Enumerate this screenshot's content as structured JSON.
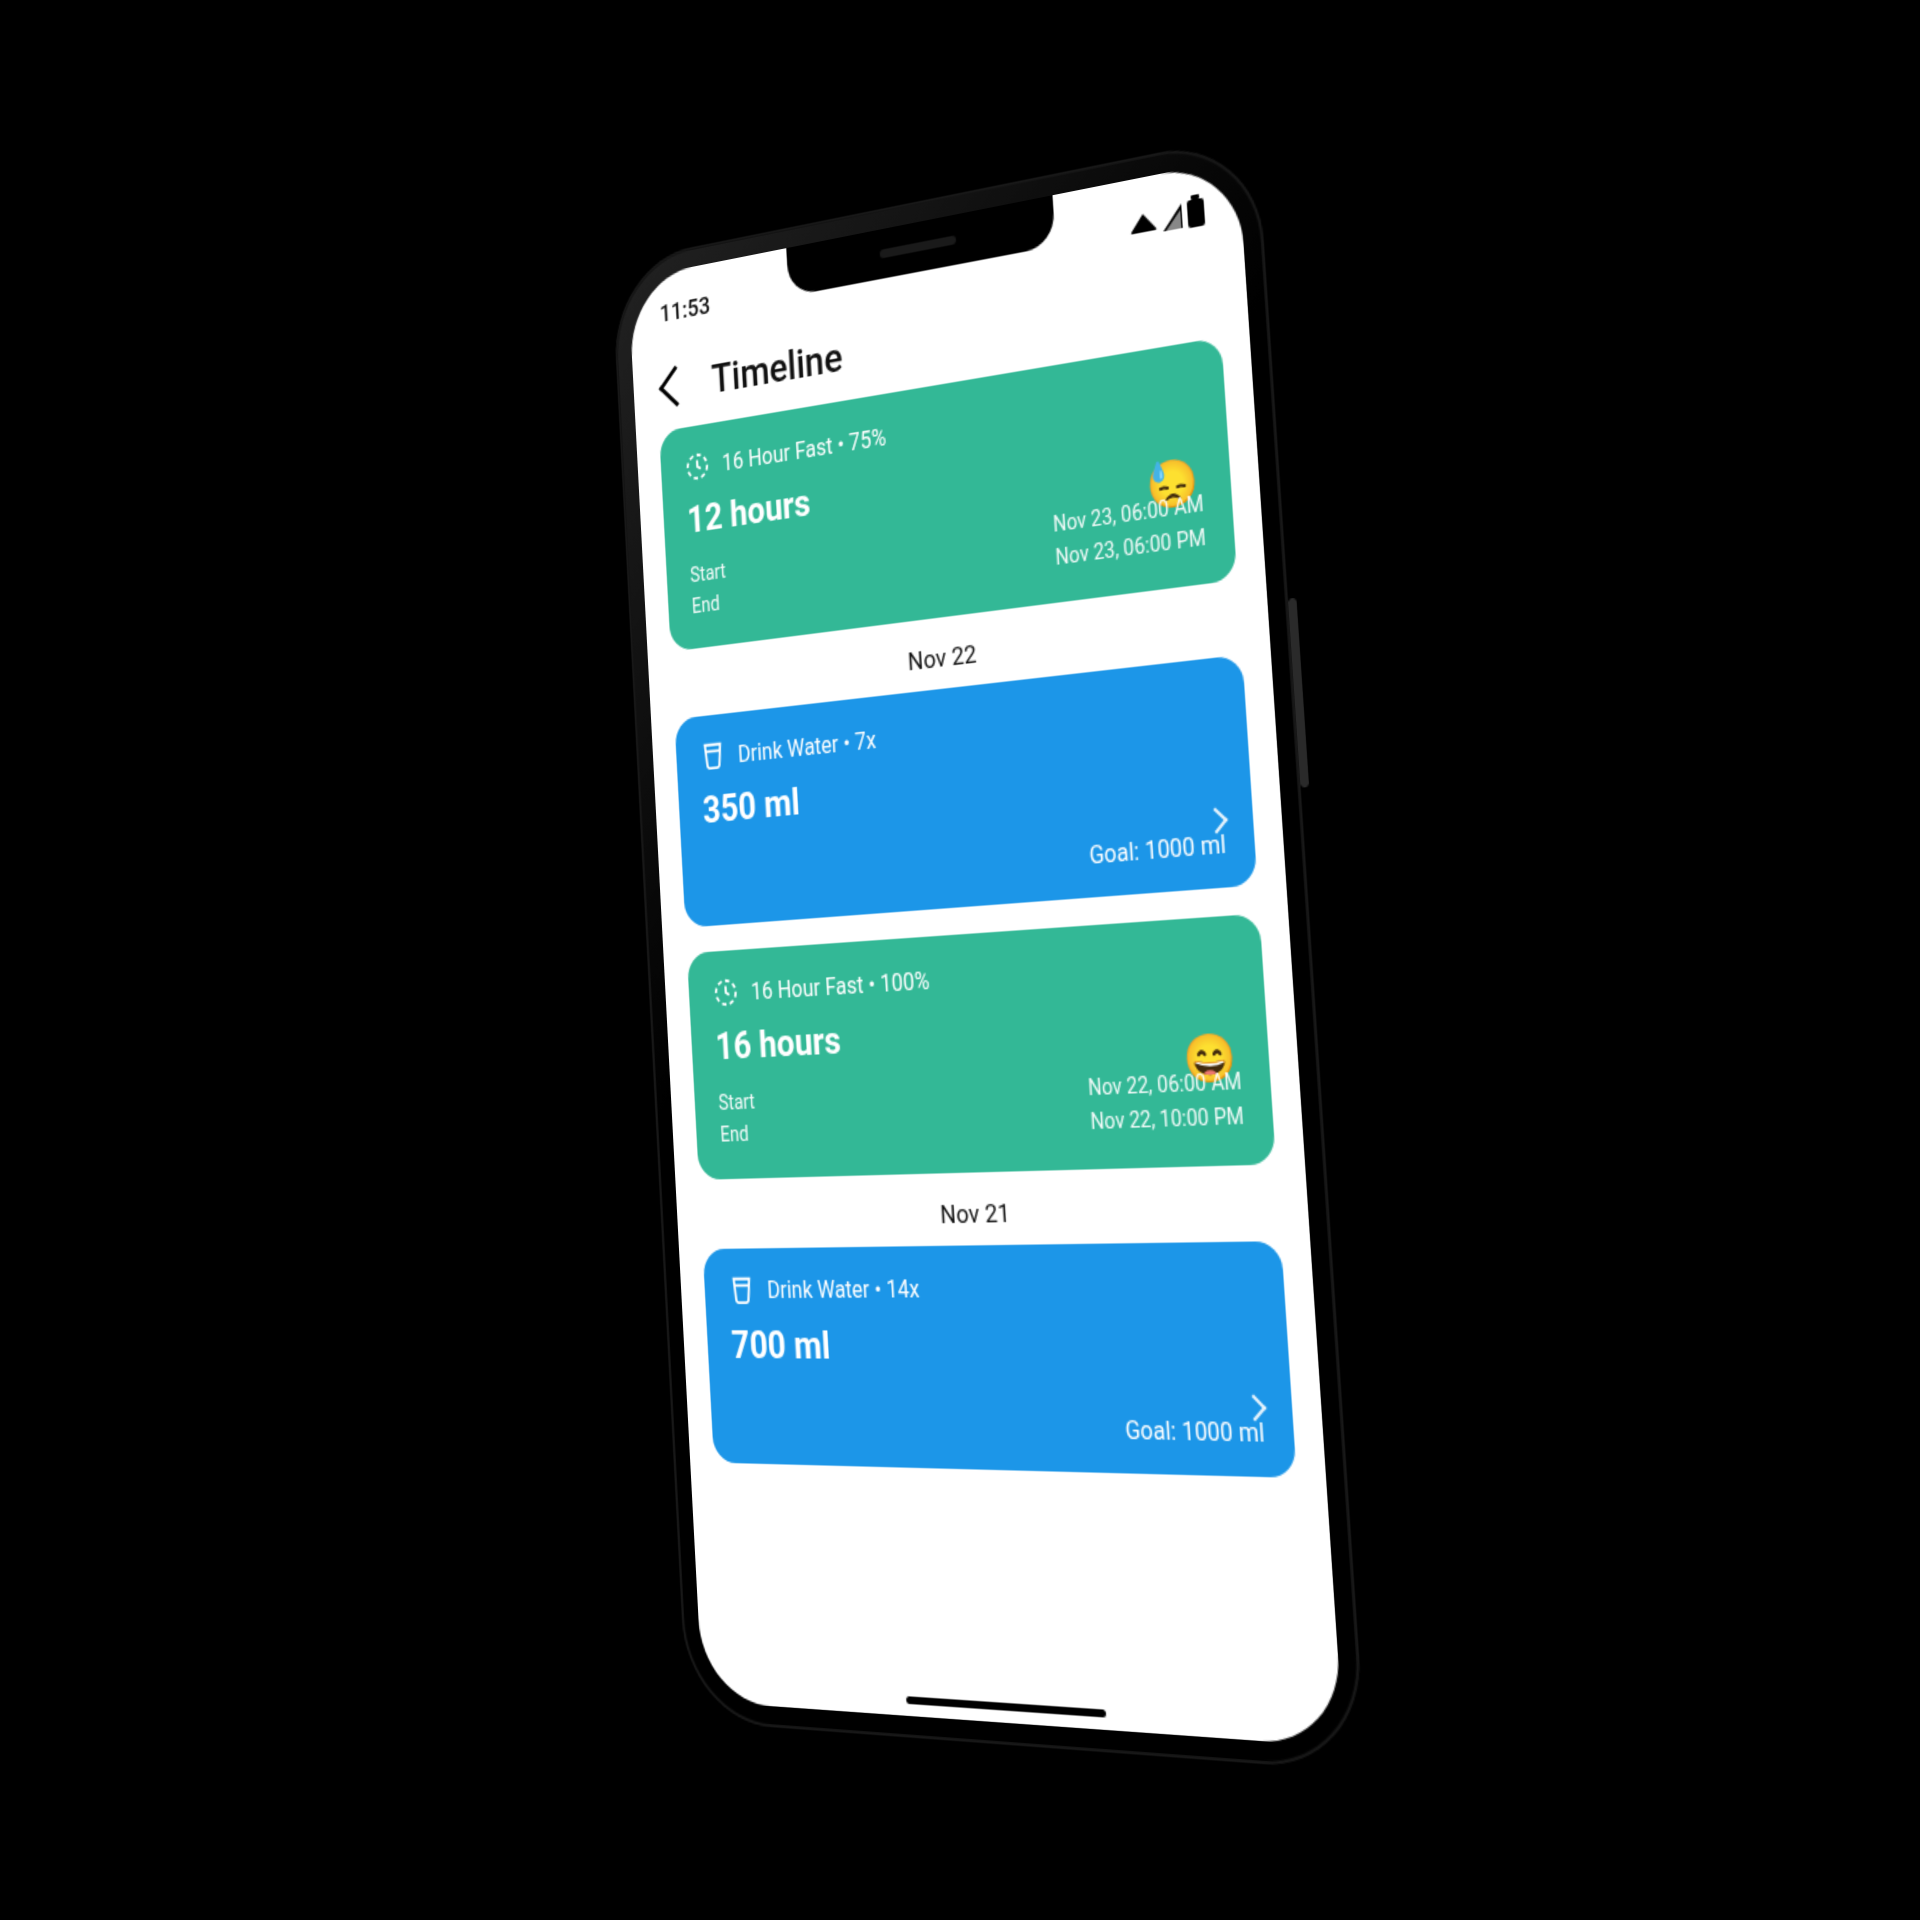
{
  "status": {
    "time": "11:53"
  },
  "header": {
    "title": "Timeline"
  },
  "sections": [
    {
      "date": "",
      "cards": [
        {
          "type": "fast",
          "title": "16 Hour Fast • 75%",
          "big": "12 hours",
          "emoji": "😓",
          "start_label": "Start",
          "end_label": "End",
          "start_val": "Nov 23, 06:00 AM",
          "end_val": "Nov 23, 06:00 PM"
        }
      ]
    },
    {
      "date": "Nov 22",
      "cards": [
        {
          "type": "water",
          "title": "Drink Water • 7x",
          "big": "350 ml",
          "goal": "Goal: 1000 ml"
        },
        {
          "type": "fast",
          "title": "16 Hour Fast • 100%",
          "big": "16 hours",
          "emoji": "😄",
          "start_label": "Start",
          "end_label": "End",
          "start_val": "Nov 22, 06:00 AM",
          "end_val": "Nov 22, 10:00 PM"
        }
      ]
    },
    {
      "date": "Nov 21",
      "cards": [
        {
          "type": "water",
          "title": "Drink Water • 14x",
          "big": "700 ml",
          "goal": "Goal: 1000 ml"
        }
      ]
    }
  ]
}
